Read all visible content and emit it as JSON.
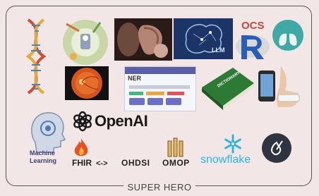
{
  "caption": "SUPER HERO",
  "logos": {
    "llm": "LLM",
    "ocs": "OCS",
    "ner": "NER",
    "book": "DICTIONARY",
    "openai": "OpenAI",
    "machine_learning": "Machine\nLearning",
    "fhir": "FHIR",
    "arrow": "<->",
    "ohdsi": "OHDSI",
    "omop": "OMOP",
    "snowflake": "snowflake"
  },
  "colors": {
    "background": "#f3e6e6",
    "openai": "#1a1a1a",
    "snowflake": "#29b5e8",
    "r_blue": "#2b5db4",
    "ocs_red": "#d0443c"
  }
}
